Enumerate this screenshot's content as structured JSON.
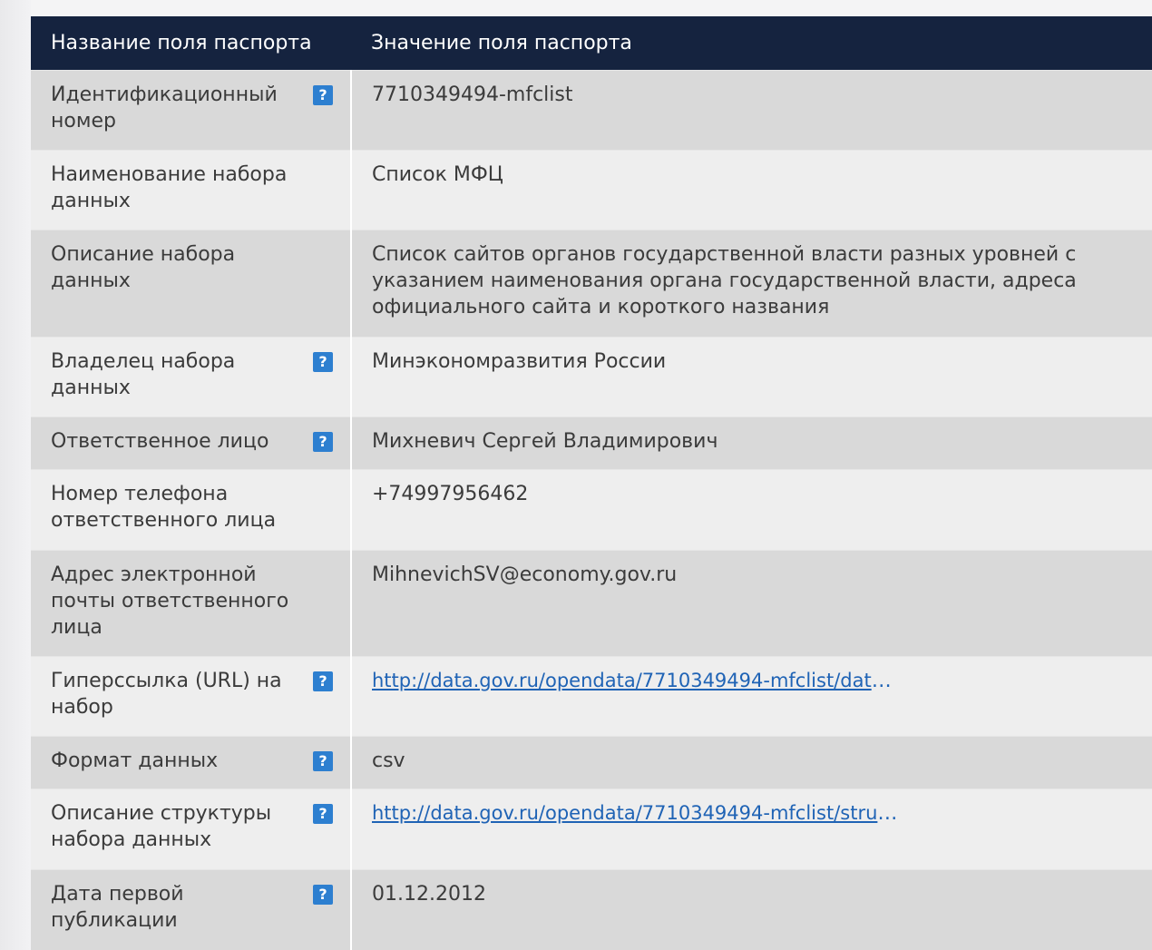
{
  "table": {
    "header": {
      "name": "Название поля паспорта",
      "value": "Значение поля паспорта"
    },
    "rows": [
      {
        "name": "Идентификационный номер",
        "value": "7710349494-mfclist",
        "help": true
      },
      {
        "name": "Наименование набора данных",
        "value": "Список МФЦ",
        "help": false
      },
      {
        "name": "Описание набора данных",
        "value": "Список сайтов органов государственной власти разных уровней с указанием наименования органа государственной власти, адреса официального сайта и короткого названия",
        "help": false
      },
      {
        "name": "Владелец набора данных",
        "value": "Минэкономразвития России",
        "help": true
      },
      {
        "name": "Ответственное лицо",
        "value": "Михневич Сергей Владимирович",
        "help": true
      },
      {
        "name": "Номер телефона ответственного лица",
        "value": "+74997956462",
        "help": false
      },
      {
        "name": "Адрес электронной почты ответственного лица",
        "value": "MihnevichSV@economy.gov.ru",
        "help": false
      },
      {
        "name": "Гиперссылка (URL) на набор",
        "value": "http://data.gov.ru/opendata/7710349494-mfclist/dat",
        "suffix": "…",
        "help": true
      },
      {
        "name": "Формат данных",
        "value": "csv",
        "help": true
      },
      {
        "name": "Описание структуры набора данных",
        "value": "http://data.gov.ru/opendata/7710349494-mfclist/stru",
        "suffix": "…",
        "help": true
      },
      {
        "name": "Дата первой публикации",
        "value": "01.12.2012",
        "help": true
      }
    ],
    "help_glyph": "?",
    "help_icon": "question-icon"
  }
}
